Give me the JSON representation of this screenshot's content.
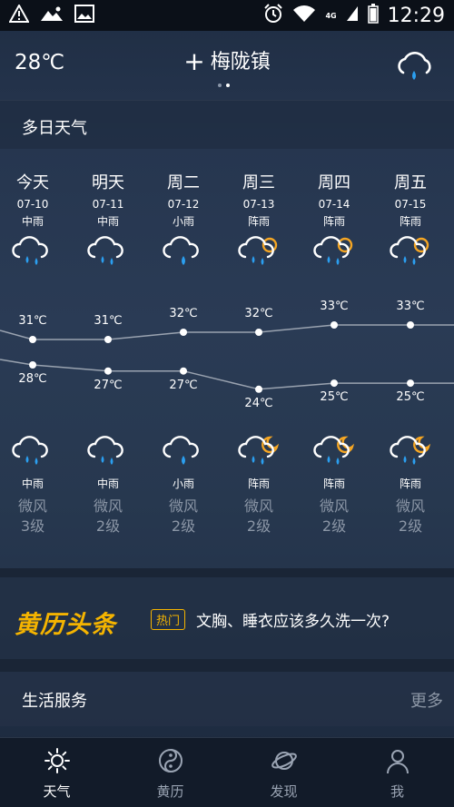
{
  "status_bar": {
    "time": "12:29",
    "network": "4G"
  },
  "header": {
    "current_temp": "28℃",
    "city": "梅陇镇",
    "plus": "+"
  },
  "section": {
    "title": "多日天气"
  },
  "days": [
    {
      "name": "今天",
      "date": "07-10",
      "day_weather": "中雨",
      "night_weather": "中雨",
      "high": "31℃",
      "low": "28℃",
      "wind": "微风",
      "wind_level": "3级",
      "day_icon": "rain-cloud-icon",
      "night_icon": "rain-cloud-icon",
      "high_value": 31,
      "low_value": 28
    },
    {
      "name": "明天",
      "date": "07-11",
      "day_weather": "中雨",
      "night_weather": "中雨",
      "high": "31℃",
      "low": "27℃",
      "wind": "微风",
      "wind_level": "2级",
      "day_icon": "rain-cloud-icon",
      "night_icon": "rain-cloud-icon",
      "high_value": 31,
      "low_value": 27
    },
    {
      "name": "周二",
      "date": "07-12",
      "day_weather": "小雨",
      "night_weather": "小雨",
      "high": "32℃",
      "low": "27℃",
      "wind": "微风",
      "wind_level": "2级",
      "day_icon": "light-rain-cloud-icon",
      "night_icon": "light-rain-cloud-icon",
      "high_value": 32,
      "low_value": 27
    },
    {
      "name": "周三",
      "date": "07-13",
      "day_weather": "阵雨",
      "night_weather": "阵雨",
      "high": "32℃",
      "low": "24℃",
      "wind": "微风",
      "wind_level": "2级",
      "day_icon": "sun-shower-icon",
      "night_icon": "moon-shower-icon",
      "high_value": 32,
      "low_value": 24
    },
    {
      "name": "周四",
      "date": "07-14",
      "day_weather": "阵雨",
      "night_weather": "阵雨",
      "high": "33℃",
      "low": "25℃",
      "wind": "微风",
      "wind_level": "2级",
      "day_icon": "sun-shower-icon",
      "night_icon": "moon-shower-icon",
      "high_value": 33,
      "low_value": 25
    },
    {
      "name": "周五",
      "date": "07-15",
      "day_weather": "阵雨",
      "night_weather": "阵雨",
      "high": "33℃",
      "low": "25℃",
      "wind": "微风",
      "wind_level": "2级",
      "day_icon": "sun-shower-icon",
      "night_icon": "moon-shower-icon",
      "high_value": 33,
      "low_value": 25
    }
  ],
  "news": {
    "logo": "黄历头条",
    "tag": "热门",
    "headline": "文胸、睡衣应该多久洗一次?"
  },
  "life": {
    "title": "生活服务",
    "more": "更多"
  },
  "tabs": [
    {
      "label": "天气",
      "icon": "sun-icon",
      "active": true
    },
    {
      "label": "黄历",
      "icon": "yin-yang-icon",
      "active": false
    },
    {
      "label": "发现",
      "icon": "planet-icon",
      "active": false
    },
    {
      "label": "我",
      "icon": "person-icon",
      "active": false
    }
  ],
  "colors": {
    "accent_yellow": "#f5b400",
    "rain_blue": "#2b9ff0",
    "sun_orange": "#f5a623"
  }
}
